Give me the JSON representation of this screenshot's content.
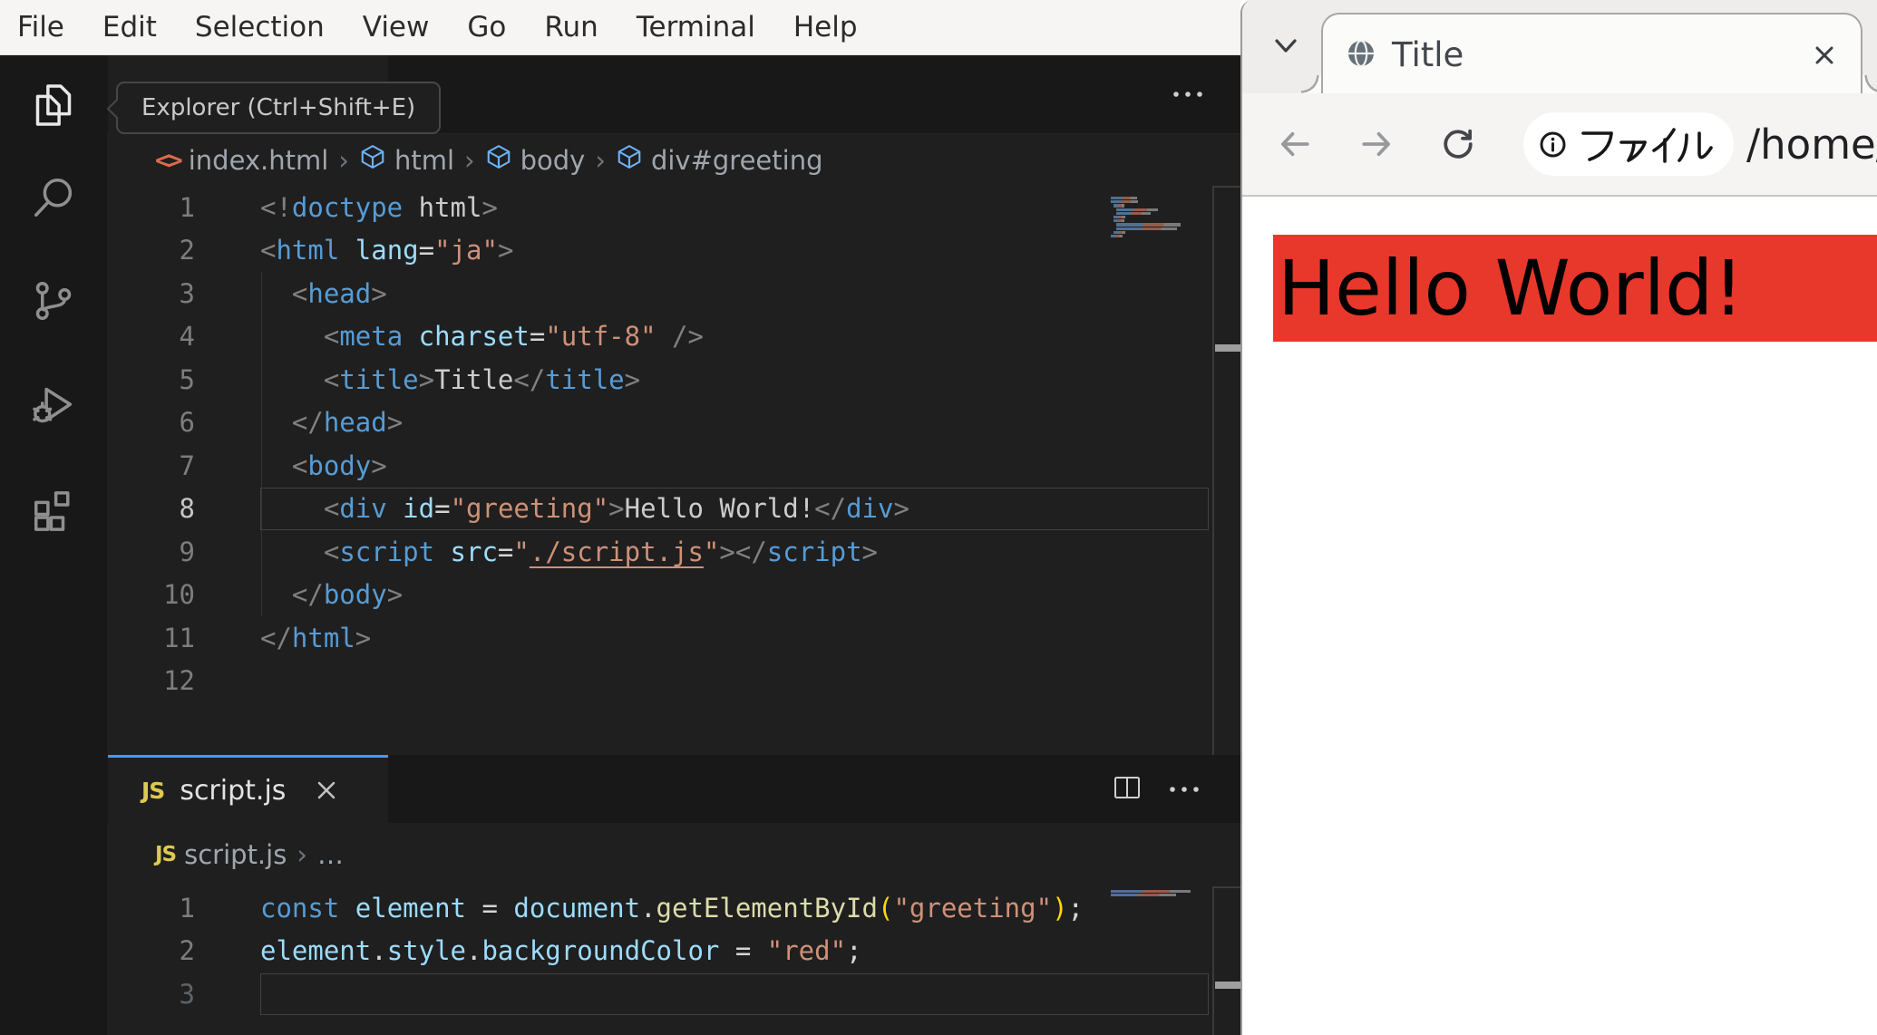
{
  "colors": {
    "editor_bg": "#1f1f1f",
    "shell_bg": "#181818",
    "menubar_bg": "#f7f5f4",
    "accent_tab_border": "#3d9bff",
    "gold_bracket": "#ffd700",
    "tag_blue": "#569cd6",
    "attr_lightblue": "#9cdcfe",
    "string_orange": "#ce9178",
    "red_banner": "#e8382b",
    "browser_chrome": "#efedec"
  },
  "icons": {
    "close": "✕",
    "more": "⋯",
    "separator": "›",
    "html_file": "<>",
    "js_badge": "JS",
    "ellipsis_item": "…"
  },
  "menu": {
    "items": [
      "File",
      "Edit",
      "Selection",
      "View",
      "Go",
      "Run",
      "Terminal",
      "Help"
    ]
  },
  "vscode": {
    "tooltip": "Explorer (Ctrl+Shift+E)",
    "activity_items": [
      "explorer",
      "search",
      "source-control",
      "run-and-debug",
      "extensions"
    ],
    "editor_html": {
      "breadcrumbs": [
        {
          "icon": "html-file",
          "label": "index.html"
        },
        {
          "icon": "cube",
          "label": "html"
        },
        {
          "icon": "cube",
          "label": "body"
        },
        {
          "icon": "cube",
          "label": "div#greeting"
        }
      ],
      "active_line": 8,
      "lines": [
        {
          "n": 1,
          "t": [
            [
              "<!",
              "p"
            ],
            [
              "doctype",
              "tag"
            ],
            [
              " html",
              "txt"
            ],
            [
              ">",
              "p"
            ]
          ]
        },
        {
          "n": 2,
          "t": [
            [
              "<",
              "p"
            ],
            [
              "html",
              "tag"
            ],
            [
              " lang",
              "attr"
            ],
            [
              "=",
              "op"
            ],
            [
              "\"ja\"",
              "str"
            ],
            [
              ">",
              "p"
            ]
          ]
        },
        {
          "n": 3,
          "t": [
            [
              "  ",
              "sp"
            ],
            [
              "<",
              "p"
            ],
            [
              "head",
              "tag"
            ],
            [
              ">",
              "p"
            ]
          ]
        },
        {
          "n": 4,
          "t": [
            [
              "    ",
              "sp"
            ],
            [
              "<",
              "p"
            ],
            [
              "meta",
              "tag"
            ],
            [
              " charset",
              "attr"
            ],
            [
              "=",
              "op"
            ],
            [
              "\"utf-8\"",
              "str"
            ],
            [
              " />",
              "p"
            ]
          ]
        },
        {
          "n": 5,
          "t": [
            [
              "    ",
              "sp"
            ],
            [
              "<",
              "p"
            ],
            [
              "title",
              "tag"
            ],
            [
              ">",
              "p"
            ],
            [
              "Title",
              "txt"
            ],
            [
              "</",
              "p"
            ],
            [
              "title",
              "tag"
            ],
            [
              ">",
              "p"
            ]
          ]
        },
        {
          "n": 6,
          "t": [
            [
              "  ",
              "sp"
            ],
            [
              "</",
              "p"
            ],
            [
              "head",
              "tag"
            ],
            [
              ">",
              "p"
            ]
          ]
        },
        {
          "n": 7,
          "t": [
            [
              "  ",
              "sp"
            ],
            [
              "<",
              "p"
            ],
            [
              "body",
              "tag"
            ],
            [
              ">",
              "p"
            ]
          ]
        },
        {
          "n": 8,
          "t": [
            [
              "    ",
              "sp"
            ],
            [
              "<",
              "p"
            ],
            [
              "div",
              "tag"
            ],
            [
              " id",
              "attr"
            ],
            [
              "=",
              "op"
            ],
            [
              "\"greeting\"",
              "str"
            ],
            [
              ">",
              "p"
            ],
            [
              "Hello World!",
              "txt"
            ],
            [
              "</",
              "p"
            ],
            [
              "div",
              "tag"
            ],
            [
              ">",
              "p"
            ]
          ]
        },
        {
          "n": 9,
          "t": [
            [
              "    ",
              "sp"
            ],
            [
              "<",
              "p"
            ],
            [
              "script",
              "tag"
            ],
            [
              " src",
              "attr"
            ],
            [
              "=",
              "op"
            ],
            [
              "\"",
              "str"
            ],
            [
              "./script.js",
              "lnk"
            ],
            [
              "\"",
              "str"
            ],
            [
              ">",
              "p"
            ],
            [
              "</",
              "p"
            ],
            [
              "script",
              "tag"
            ],
            [
              ">",
              "p"
            ]
          ]
        },
        {
          "n": 10,
          "t": [
            [
              "  ",
              "sp"
            ],
            [
              "</",
              "p"
            ],
            [
              "body",
              "tag"
            ],
            [
              ">",
              "p"
            ]
          ]
        },
        {
          "n": 11,
          "t": [
            [
              "</",
              "p"
            ],
            [
              "html",
              "tag"
            ],
            [
              ">",
              "p"
            ]
          ]
        },
        {
          "n": 12,
          "t": []
        }
      ]
    },
    "editor_js": {
      "tab_label": "script.js",
      "breadcrumbs": [
        {
          "icon": "js",
          "label": "script.js"
        },
        {
          "icon": "none",
          "label": "…"
        }
      ],
      "active_line": 3,
      "dim_line": 3,
      "lines": [
        {
          "n": 1,
          "t": [
            [
              "const",
              "kw"
            ],
            [
              " ",
              "sp"
            ],
            [
              "element",
              "id"
            ],
            [
              " = ",
              "op"
            ],
            [
              "document",
              "id"
            ],
            [
              ".",
              "op"
            ],
            [
              "getElementById",
              "fn"
            ],
            [
              "(",
              "gold"
            ],
            [
              "\"greeting\"",
              "str"
            ],
            [
              ")",
              "gold"
            ],
            [
              ";",
              "op"
            ]
          ]
        },
        {
          "n": 2,
          "t": [
            [
              "element",
              "id"
            ],
            [
              ".",
              "op"
            ],
            [
              "style",
              "id"
            ],
            [
              ".",
              "op"
            ],
            [
              "backgroundColor",
              "id"
            ],
            [
              " = ",
              "op"
            ],
            [
              "\"red\"",
              "str"
            ],
            [
              ";",
              "op"
            ]
          ]
        },
        {
          "n": 3,
          "t": []
        }
      ]
    }
  },
  "browser": {
    "tab_title": "Title",
    "address_chip": "ファイル",
    "url": "/home/u",
    "page_text": "Hello World!"
  }
}
